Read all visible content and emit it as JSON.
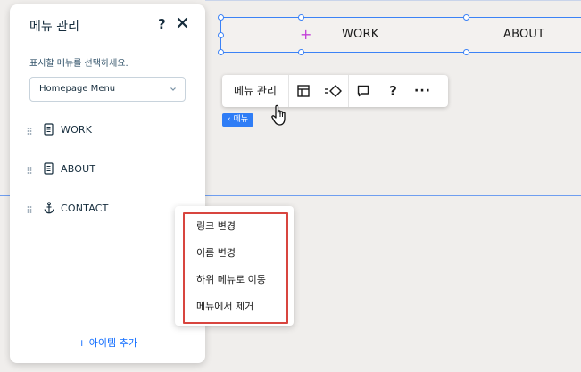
{
  "canvas": {
    "menu_items": [
      "WORK",
      "ABOUT"
    ]
  },
  "toolbar": {
    "manage_menu_label": "메뉴 관리",
    "help_glyph": "?",
    "more_glyph": "···"
  },
  "menu_chip": {
    "label": "‹ 메뉴"
  },
  "panel": {
    "title": "메뉴 관리",
    "help_glyph": "?",
    "select_label": "표시할 메뉴를 선택하세요.",
    "selected_menu": "Homepage Menu",
    "items": [
      {
        "label": "WORK",
        "icon": "page-icon"
      },
      {
        "label": "ABOUT",
        "icon": "page-icon"
      },
      {
        "label": "CONTACT",
        "icon": "anchor-icon"
      }
    ],
    "add_item_label": "+ 아이템 추가"
  },
  "context_menu": {
    "items": [
      "링크 변경",
      "이름 변경",
      "하위 메뉴로 이동",
      "메뉴에서 제거"
    ]
  },
  "colors": {
    "accent": "#116dff",
    "selection": "#3b82f6",
    "highlight": "#d8453f"
  }
}
